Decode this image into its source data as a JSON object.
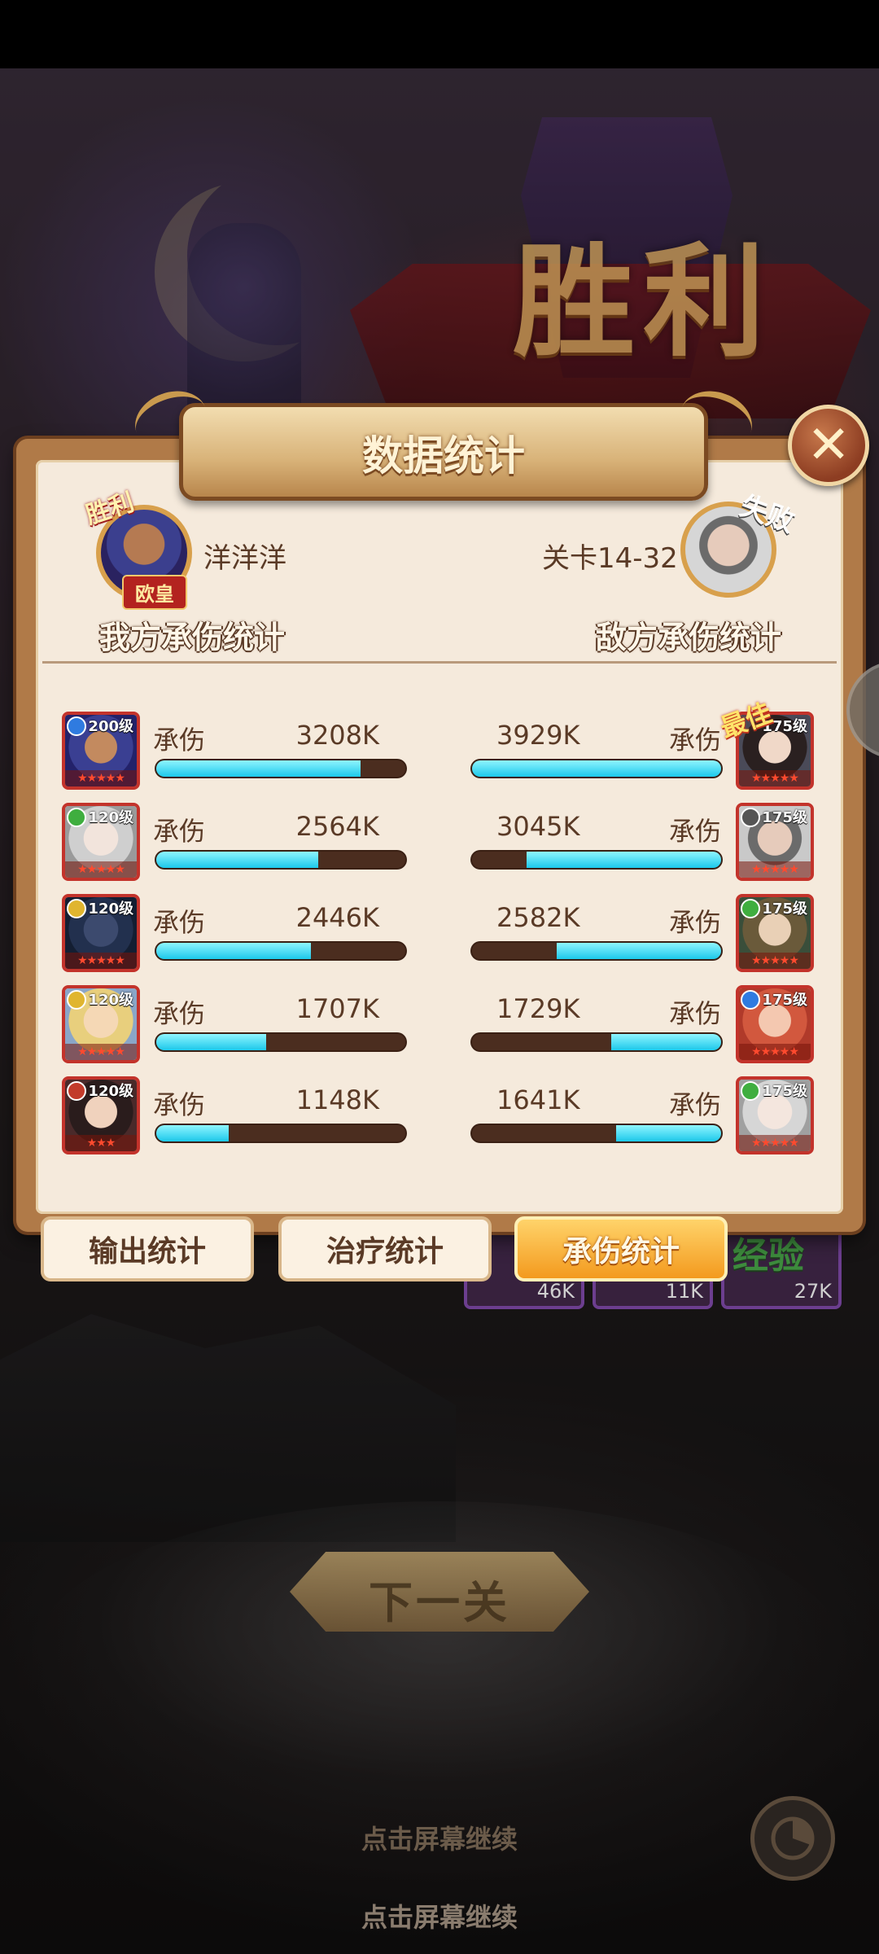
{
  "background": {
    "victory_text": "胜利",
    "next_button": "下一关",
    "continue_hint_1": "点击屏幕继续",
    "continue_hint_2": "点击屏幕继续",
    "rewards": [
      {
        "value": "46K"
      },
      {
        "value": "11K"
      },
      {
        "value": "27K",
        "label": "经验"
      }
    ]
  },
  "dialog": {
    "title": "数据统计",
    "close_icon": "close-icon",
    "player": {
      "name": "洋洋洋",
      "badge": "胜利",
      "rank": "欧皇",
      "section_title": "我方承伤统计"
    },
    "enemy": {
      "stage": "关卡14-32",
      "badge": "失败",
      "section_title": "敌方承伤统计",
      "best_badge": "最佳"
    },
    "stat_label": "承伤",
    "left_rows": [
      {
        "level": "200级",
        "value": "3208K",
        "fill": 0.82,
        "stars": "★★★★★",
        "faction": "#2f7be0"
      },
      {
        "level": "120级",
        "value": "2564K",
        "fill": 0.65,
        "stars": "★★★★★",
        "faction": "#3fae3f"
      },
      {
        "level": "120级",
        "value": "2446K",
        "fill": 0.62,
        "stars": "★★★★★",
        "faction": "#e0b52f"
      },
      {
        "level": "120级",
        "value": "1707K",
        "fill": 0.44,
        "stars": "★★★★★",
        "faction": "#e0b52f"
      },
      {
        "level": "120级",
        "value": "1148K",
        "fill": 0.29,
        "stars": "★★★",
        "faction": "#c23b2b"
      }
    ],
    "right_rows": [
      {
        "level": "175级",
        "value": "3929K",
        "fill": 1.0,
        "stars": "★★★★★",
        "faction": ""
      },
      {
        "level": "175级",
        "value": "3045K",
        "fill": 0.78,
        "stars": "★★★★★",
        "faction": "#555555"
      },
      {
        "level": "175级",
        "value": "2582K",
        "fill": 0.66,
        "stars": "★★★★★",
        "faction": "#3fae3f"
      },
      {
        "level": "175级",
        "value": "1729K",
        "fill": 0.44,
        "stars": "★★★★★",
        "faction": "#2f7be0"
      },
      {
        "level": "175级",
        "value": "1641K",
        "fill": 0.42,
        "stars": "★★★★★",
        "faction": "#3fae3f"
      }
    ],
    "tabs": [
      {
        "label": "输出统计",
        "active": false
      },
      {
        "label": "治疗统计",
        "active": false
      },
      {
        "label": "承伤统计",
        "active": true
      }
    ]
  },
  "colors": {
    "bar_fill": "#1cc8ea",
    "bar_track": "#4b2d1f",
    "tab_active": "#f39a1e"
  }
}
